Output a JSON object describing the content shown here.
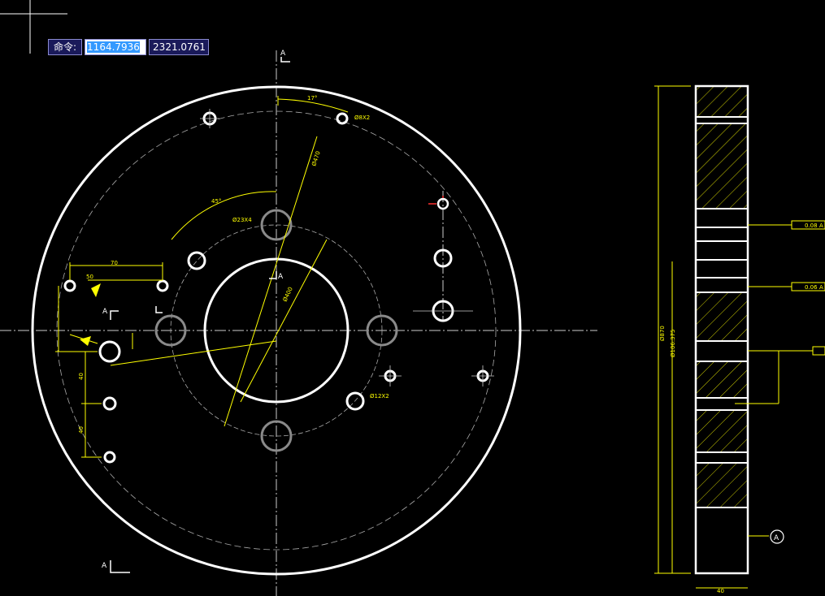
{
  "command": {
    "label": "命令:",
    "x_value": "1164.7936",
    "y_value": "2321.0761"
  },
  "colors": {
    "background": "#000000",
    "outline": "#ffffff",
    "dimension": "#ffff00",
    "hidden_hole": "#808080",
    "marker": "#ff0000"
  },
  "section_labels": {
    "section_a_top": "A",
    "section_a_bottom": "A",
    "section_a_left": "A",
    "section_a_center": "A",
    "datum_a": "A"
  },
  "dimensions": {
    "angle_17": "17°",
    "angle_45": "45°",
    "dia_470": "Ø470",
    "dia_400": "Ø400",
    "hole_23x4": "Ø23X4",
    "hole_8x2": "Ø8X2",
    "hole_12x2": "Ø12X2",
    "dim_70": "70",
    "dim_50": "50",
    "dim_40a": "40",
    "dim_40b": "40",
    "dim_40_bottom": "40",
    "dia_870": "Ø870",
    "dia_inner": "Ø106.375",
    "tol_1": "0.08",
    "tol_2": "0.06",
    "tol_a1": "A",
    "tol_a2": "A"
  }
}
